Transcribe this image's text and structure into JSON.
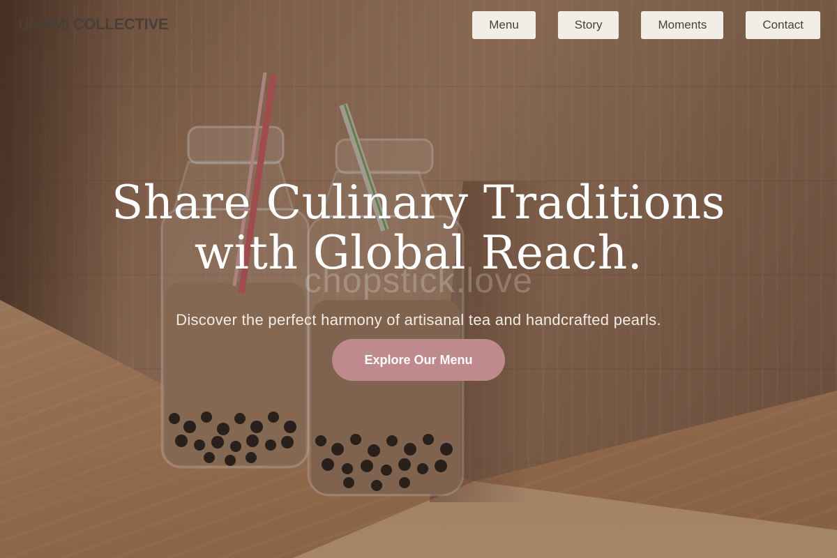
{
  "brand": {
    "name": "UMAMI COLLECTIVE"
  },
  "nav": {
    "items": [
      {
        "label": "Menu"
      },
      {
        "label": "Story"
      },
      {
        "label": "Moments"
      },
      {
        "label": "Contact"
      }
    ]
  },
  "hero": {
    "headline_line1": "Share Culinary Traditions",
    "headline_line2": "with Global Reach.",
    "subheadline": "Discover the perfect harmony of artisanal tea and handcrafted pearls.",
    "cta_label": "Explore Our Menu",
    "watermark": "chopstick.love"
  },
  "colors": {
    "accent": "#bf8a8d",
    "nav_button_bg": "#f1ede7",
    "brand_text": "#4a3e37"
  }
}
